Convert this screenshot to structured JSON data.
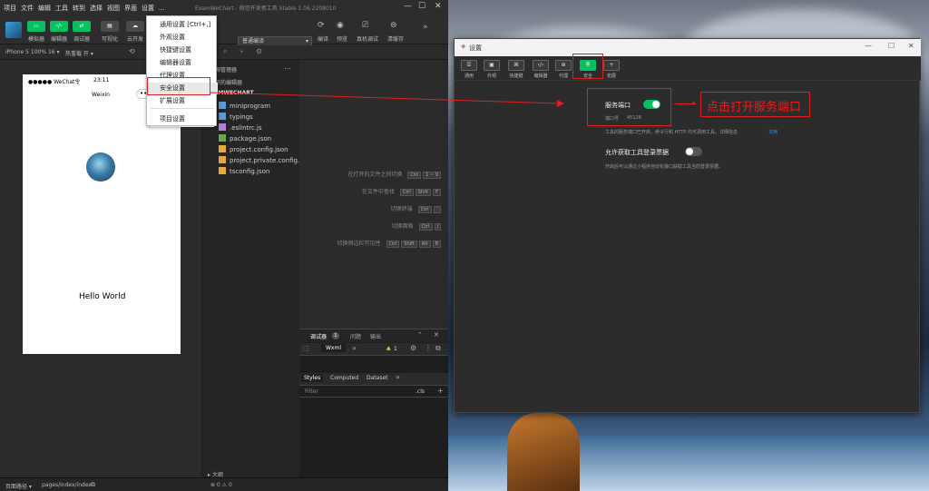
{
  "ide": {
    "menus": [
      "项目",
      "文件",
      "编辑",
      "工具",
      "转到",
      "选择",
      "视图",
      "界面",
      "设置",
      "..."
    ],
    "window_title": "ExamWeChart - 微信开发者工具 Stable 1.06.2208010",
    "toolbar": [
      {
        "label": "模拟器",
        "icon": "phone-icon",
        "active": true
      },
      {
        "label": "编辑器",
        "icon": "code-icon",
        "active": true
      },
      {
        "label": "调试器",
        "icon": "debug-icon",
        "active": true
      },
      {
        "label": "可视化",
        "icon": "visual-icon",
        "active": false
      },
      {
        "label": "云开发",
        "icon": "cloud-icon",
        "active": false
      }
    ],
    "compile_mode": "普通编译",
    "toolbar_right": [
      "编译",
      "预览",
      "真机调试",
      "清缓存"
    ],
    "device": "iPhone 5 100% 16 ▾",
    "hot_reload": "热重载 开 ▾",
    "phone": {
      "carrier": "●●●●● WeChat令",
      "time": "23:11",
      "title": "Weixin",
      "hello": "Hello World"
    },
    "explorer": {
      "title": "资源管理器",
      "section_open": "打开的编辑器",
      "project": "EXAMWECHART",
      "files": [
        {
          "name": "miniprogram",
          "icon": "folder-icon",
          "color": "#5f9ad6"
        },
        {
          "name": "typings",
          "icon": "folder-icon",
          "color": "#5f9ad6"
        },
        {
          "name": ".eslintrc.js",
          "icon": "js-file-icon",
          "color": "#b084d8"
        },
        {
          "name": "package.json",
          "icon": "npm-file-icon",
          "color": "#6aa84f"
        },
        {
          "name": "project.config.json",
          "icon": "json-file-icon",
          "color": "#e5a83a"
        },
        {
          "name": "project.private.config.js...",
          "icon": "json-file-icon",
          "color": "#e5a83a"
        },
        {
          "name": "tsconfig.json",
          "icon": "json-file-icon",
          "color": "#e5a83a"
        }
      ],
      "outline": "大纲"
    },
    "shortcuts": [
      {
        "label": "在打开的文件之间切换",
        "keys": [
          "Ctrl",
          "1 ~ 9"
        ]
      },
      {
        "label": "在文件中查找",
        "keys": [
          "Ctrl",
          "Shift",
          "F"
        ]
      },
      {
        "label": "切换终端",
        "keys": [
          "Ctrl",
          "`"
        ]
      },
      {
        "label": "切换面板",
        "keys": [
          "Ctrl",
          "J"
        ]
      },
      {
        "label": "切换侧边栏可见性",
        "keys": [
          "Ctrl",
          "Shift",
          "Alt",
          "B"
        ]
      }
    ],
    "debug": {
      "tabs": [
        "调试器",
        "问题",
        "输出"
      ],
      "badge": "1",
      "panel_tab": "Wxml",
      "warn_count": "1",
      "style_tabs": [
        "Styles",
        "Computed",
        "Dataset"
      ],
      "filter_placeholder": "Filter",
      "cls": ".cls"
    },
    "status": {
      "path_label": "页面路径 ▾",
      "path": "pages/index/index",
      "counts": "⊗ 0 ⚠ 0"
    }
  },
  "dropdown": {
    "items": [
      "通用设置 [Ctrl+,]",
      "外观设置",
      "快捷键设置",
      "编辑器设置",
      "代理设置",
      "安全设置",
      "扩展设置",
      "项目设置"
    ],
    "highlighted": "安全设置"
  },
  "settings": {
    "title": "设置",
    "tabs": [
      {
        "label": "通用",
        "icon": "general-icon"
      },
      {
        "label": "外观",
        "icon": "appearance-icon"
      },
      {
        "label": "快捷键",
        "icon": "shortcut-icon"
      },
      {
        "label": "编辑器",
        "icon": "editor-icon"
      },
      {
        "label": "代理",
        "icon": "proxy-icon"
      },
      {
        "label": "安全",
        "icon": "security-icon"
      },
      {
        "label": "拓展",
        "icon": "extension-icon"
      }
    ],
    "active_tab": "安全",
    "service_port": {
      "label": "服务端口",
      "enabled": true,
      "port_label": "端口号",
      "port_value": "45128",
      "desc": "工具的服务端口已开启，命令行和 HTTP 均可调用工具。详细信息",
      "doc_link": "文档"
    },
    "login_data": {
      "label": "允许获取工具登录票据",
      "enabled": false,
      "desc": "开启后可以通过小程序自动化接口获取工具当前登录票据。"
    },
    "window_controls": [
      "—",
      "☐",
      "✕"
    ]
  },
  "annotation": {
    "text": "点击打开服务端口",
    "color": "#e02020"
  },
  "colors": {
    "accent": "#07c160",
    "annotation": "#e02020"
  }
}
